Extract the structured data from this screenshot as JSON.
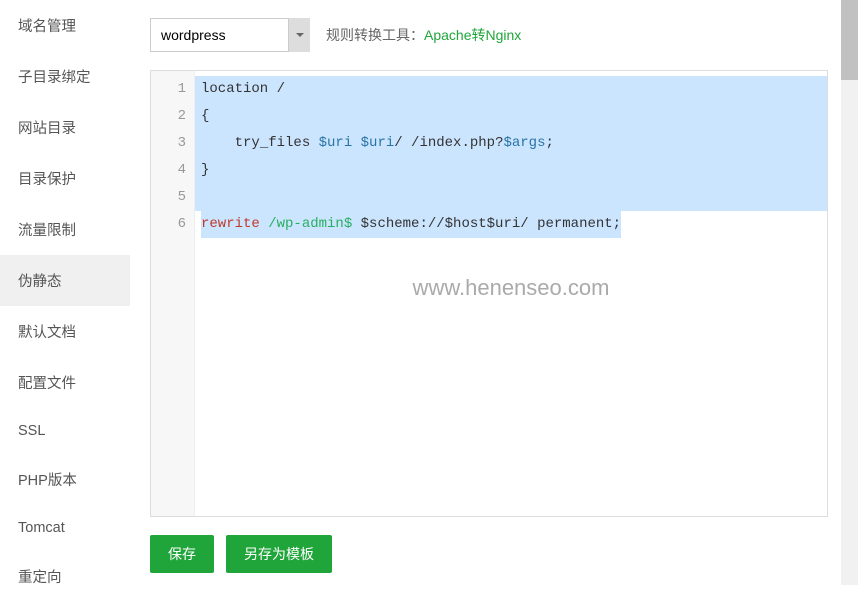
{
  "sidebar": {
    "items": [
      {
        "label": "域名管理",
        "active": false
      },
      {
        "label": "子目录绑定",
        "active": false
      },
      {
        "label": "网站目录",
        "active": false
      },
      {
        "label": "目录保护",
        "active": false
      },
      {
        "label": "流量限制",
        "active": false
      },
      {
        "label": "伪静态",
        "active": true
      },
      {
        "label": "默认文档",
        "active": false
      },
      {
        "label": "配置文件",
        "active": false
      },
      {
        "label": "SSL",
        "active": false
      },
      {
        "label": "PHP版本",
        "active": false
      },
      {
        "label": "Tomcat",
        "active": false
      },
      {
        "label": "重定向",
        "active": false
      }
    ]
  },
  "toolbar": {
    "select_value": "wordpress",
    "label": "规则转换工具：",
    "link": "Apache转Nginx"
  },
  "editor": {
    "lines": [
      "1",
      "2",
      "3",
      "4",
      "5",
      "6"
    ],
    "code": {
      "l1_a": "location /",
      "l2_a": "{",
      "l3_indent": "    ",
      "l3_a": "try_files ",
      "l3_b": "$uri",
      "l3_c": " ",
      "l3_d": "$uri",
      "l3_e": "/ /index.php?",
      "l3_f": "$args",
      "l3_g": ";",
      "l4_a": "}",
      "l6_a": "rewrite",
      "l6_b": " ",
      "l6_c": "/wp-admin$",
      "l6_d": " $scheme://$host$uri/ permanent;"
    }
  },
  "watermark": "www.henenseo.com",
  "actions": {
    "save": "保存",
    "save_as": "另存为模板"
  }
}
